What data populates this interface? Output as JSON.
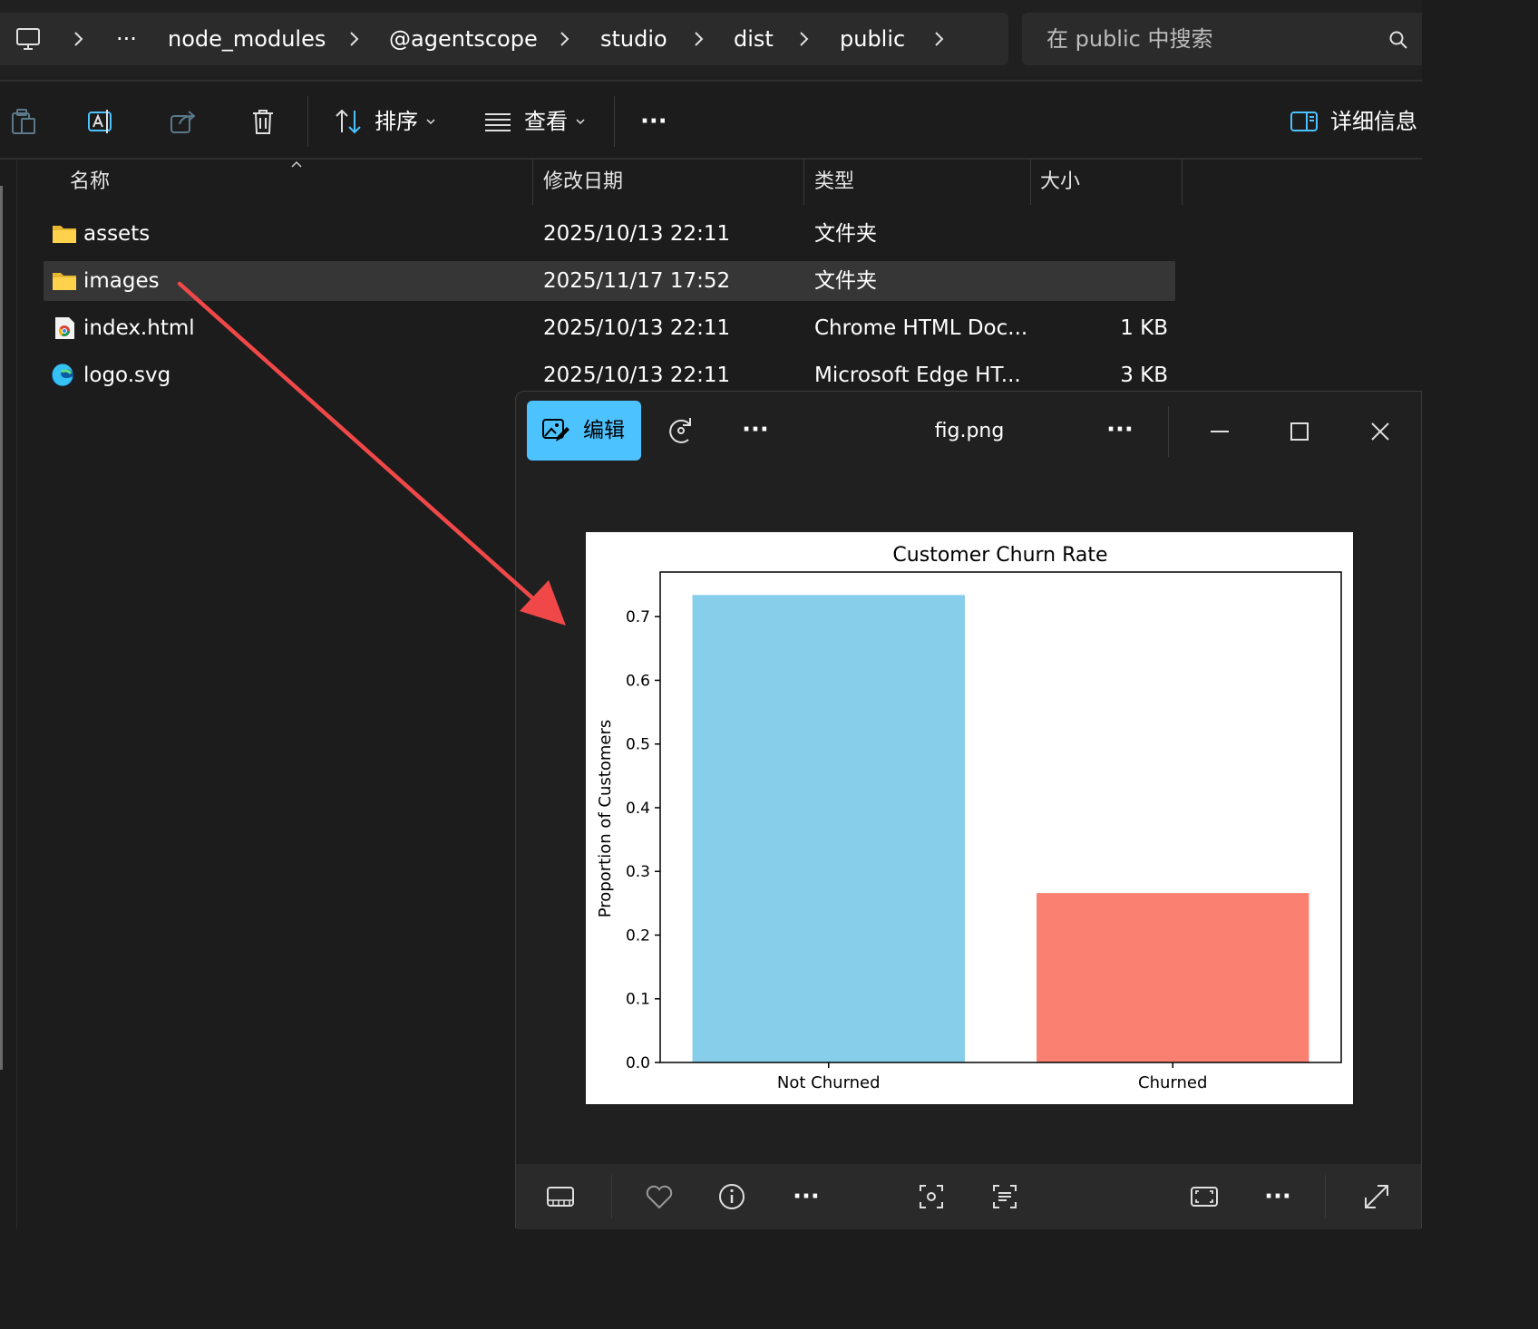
{
  "breadcrumb": {
    "overflow": "···",
    "items": [
      "node_modules",
      "@agentscope",
      "studio",
      "dist",
      "public"
    ]
  },
  "search": {
    "placeholder": "在 public 中搜索"
  },
  "toolbar": {
    "sort_label": "排序",
    "view_label": "查看",
    "more_label": "···",
    "details_label": "详细信息"
  },
  "columns": {
    "name": "名称",
    "modified": "修改日期",
    "type": "类型",
    "size": "大小"
  },
  "files": [
    {
      "name": "assets",
      "modified": "2025/10/13 22:11",
      "type": "文件夹",
      "size": "",
      "icon": "folder-icon"
    },
    {
      "name": "images",
      "modified": "2025/11/17 17:52",
      "type": "文件夹",
      "size": "",
      "icon": "folder-icon",
      "selected": true
    },
    {
      "name": "index.html",
      "modified": "2025/10/13 22:11",
      "type": "Chrome HTML Doc...",
      "size": "1 KB",
      "icon": "chrome-html-icon"
    },
    {
      "name": "logo.svg",
      "modified": "2025/10/13 22:11",
      "type": "Microsoft Edge HT...",
      "size": "3 KB",
      "icon": "edge-icon"
    }
  ],
  "viewer": {
    "edit_label": "编辑",
    "file_name": "fig.png",
    "more_label": "···"
  },
  "colors": {
    "accent": "#4cc2ff",
    "arrow": "#f04848",
    "bar_not_churned": "#87ceeb",
    "bar_churned": "#fa8072"
  },
  "chart_data": {
    "type": "bar",
    "title": "Customer Churn Rate",
    "xlabel": "",
    "ylabel": "Proportion of Customers",
    "categories": [
      "Not Churned",
      "Churned"
    ],
    "values": [
      0.734,
      0.266
    ],
    "ylim": [
      0,
      0.77
    ],
    "yticks": [
      "0.0",
      "0.1",
      "0.2",
      "0.3",
      "0.4",
      "0.5",
      "0.6",
      "0.7"
    ],
    "grid": false,
    "legend": "none"
  }
}
